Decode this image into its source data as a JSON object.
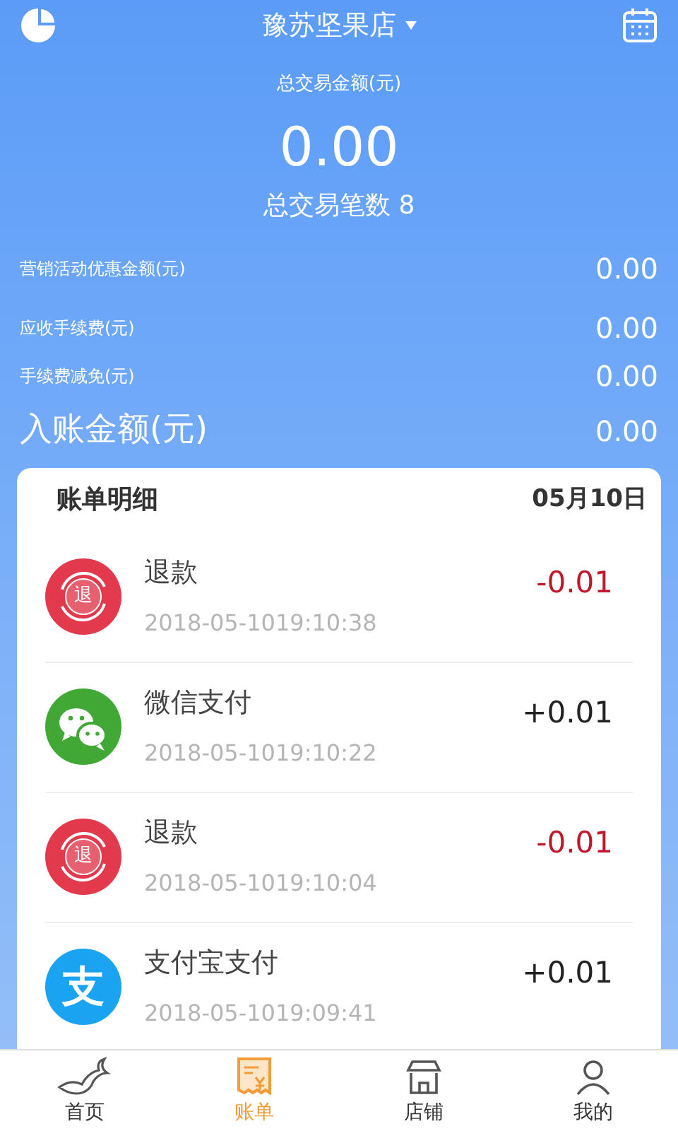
{
  "header": {
    "store_name": "豫苏坚果店"
  },
  "summary": {
    "total_label": "总交易金额(元)",
    "total_value": "0.00",
    "count_label": "总交易笔数",
    "count_value": "8"
  },
  "details": [
    {
      "label": "营销活动优惠金额(元)",
      "value": "0.00"
    },
    {
      "label": "应收手续费(元)",
      "value": "0.00"
    },
    {
      "label": "手续费减免(元)",
      "value": "0.00"
    }
  ],
  "net": {
    "label": "入账金额(元)",
    "value": "0.00"
  },
  "bill": {
    "title": "账单明细",
    "date": "05月10日",
    "transactions": [
      {
        "kind": "refund",
        "badge": "退",
        "title": "退款",
        "time": "2018-05-1019:10:38",
        "amount": "-0.01"
      },
      {
        "kind": "wechat",
        "title": "微信支付",
        "time": "2018-05-1019:10:22",
        "amount": "+0.01"
      },
      {
        "kind": "refund",
        "badge": "退",
        "title": "退款",
        "time": "2018-05-1019:10:04",
        "amount": "-0.01"
      },
      {
        "kind": "alipay",
        "badge": "支",
        "title": "支付宝支付",
        "time": "2018-05-1019:09:41",
        "amount": "+0.01"
      }
    ]
  },
  "tabs": [
    {
      "kind": "home",
      "label": "首页",
      "selected": false
    },
    {
      "kind": "bill",
      "label": "账单",
      "selected": true
    },
    {
      "kind": "store",
      "label": "店铺",
      "selected": false
    },
    {
      "kind": "me",
      "label": "我的",
      "selected": false
    }
  ]
}
